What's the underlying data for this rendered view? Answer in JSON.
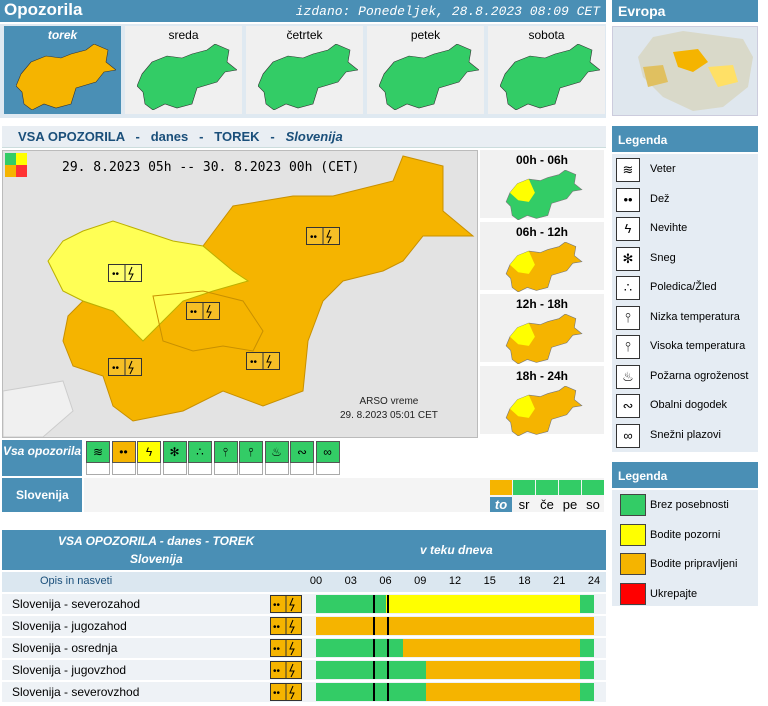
{
  "header": {
    "title": "Opozorila",
    "issued": "izdano: Ponedeljek, 28.8.2023 08:09 CET",
    "europe": "Evropa"
  },
  "days": [
    {
      "label": "torek",
      "level": "orange"
    },
    {
      "label": "sreda",
      "level": "green"
    },
    {
      "label": "četrtek",
      "level": "green"
    },
    {
      "label": "petek",
      "level": "green"
    },
    {
      "label": "sobota",
      "level": "green"
    }
  ],
  "section": {
    "a": "VSA OPOZORILA",
    "sep": "-",
    "b": "danes",
    "c": "TOREK",
    "d": "Slovenija"
  },
  "map": {
    "range": "29. 8.2023  05h  --  30. 8.2023  00h    (CET)",
    "credit1": "ARSO vreme",
    "credit2": "29. 8.2023  05:01 CET"
  },
  "periods": [
    "00h - 06h",
    "06h - 12h",
    "12h - 18h",
    "18h - 24h"
  ],
  "types_label": "Vsa opozorila",
  "slovenia_label": "Slovenija",
  "day_tabs": [
    {
      "label": "to",
      "level": "orange"
    },
    {
      "label": "sr",
      "level": "green"
    },
    {
      "label": "če",
      "level": "green"
    },
    {
      "label": "pe",
      "level": "green"
    },
    {
      "label": "so",
      "level": "green"
    }
  ],
  "table": {
    "title": "VSA OPOZORILA - danes - TOREK",
    "subtitle": "Slovenija",
    "right": "v teku dneva",
    "opis": "Opis in nasveti",
    "hours": [
      "00",
      "03",
      "06",
      "09",
      "12",
      "15",
      "18",
      "21",
      "24"
    ],
    "rows": [
      {
        "name": "Slovenija - severozahod",
        "segments": [
          {
            "from": 0,
            "to": 6,
            "c": "green"
          },
          {
            "from": 6,
            "to": 22.8,
            "c": "yellow"
          },
          {
            "from": 22.8,
            "to": 24,
            "c": "green"
          }
        ]
      },
      {
        "name": "Slovenija - jugozahod",
        "segments": [
          {
            "from": 0,
            "to": 24,
            "c": "orange"
          }
        ]
      },
      {
        "name": "Slovenija - osrednja",
        "segments": [
          {
            "from": 0,
            "to": 7.5,
            "c": "green"
          },
          {
            "from": 7.5,
            "to": 22.8,
            "c": "orange"
          },
          {
            "from": 22.8,
            "to": 24,
            "c": "green"
          }
        ]
      },
      {
        "name": "Slovenija - jugovzhod",
        "segments": [
          {
            "from": 0,
            "to": 9.5,
            "c": "green"
          },
          {
            "from": 9.5,
            "to": 22.8,
            "c": "orange"
          },
          {
            "from": 22.8,
            "to": 24,
            "c": "green"
          }
        ]
      },
      {
        "name": "Slovenija - severovzhod",
        "segments": [
          {
            "from": 0,
            "to": 9.5,
            "c": "green"
          },
          {
            "from": 9.5,
            "to": 22.8,
            "c": "orange"
          },
          {
            "from": 22.8,
            "to": 24,
            "c": "green"
          }
        ]
      }
    ]
  },
  "legend1": {
    "title": "Legenda",
    "items": [
      "Veter",
      "Dež",
      "Nevihte",
      "Sneg",
      "Poledica/Žled",
      "Nizka temperatura",
      "Visoka temperatura",
      "Požarna ogroženost",
      "Obalni dogodek",
      "Snežni plazovi"
    ]
  },
  "legend2": {
    "title": "Legenda",
    "items": [
      {
        "label": "Brez posebnosti",
        "color": "#33cc66"
      },
      {
        "label": "Bodite pozorni",
        "color": "#ffff00"
      },
      {
        "label": "Bodite pripravljeni",
        "color": "#f5b400"
      },
      {
        "label": "Ukrepajte",
        "color": "#ff0000"
      }
    ]
  },
  "colors": {
    "green": "#33cc66",
    "yellow": "#ffff00",
    "orange": "#f5b400"
  }
}
